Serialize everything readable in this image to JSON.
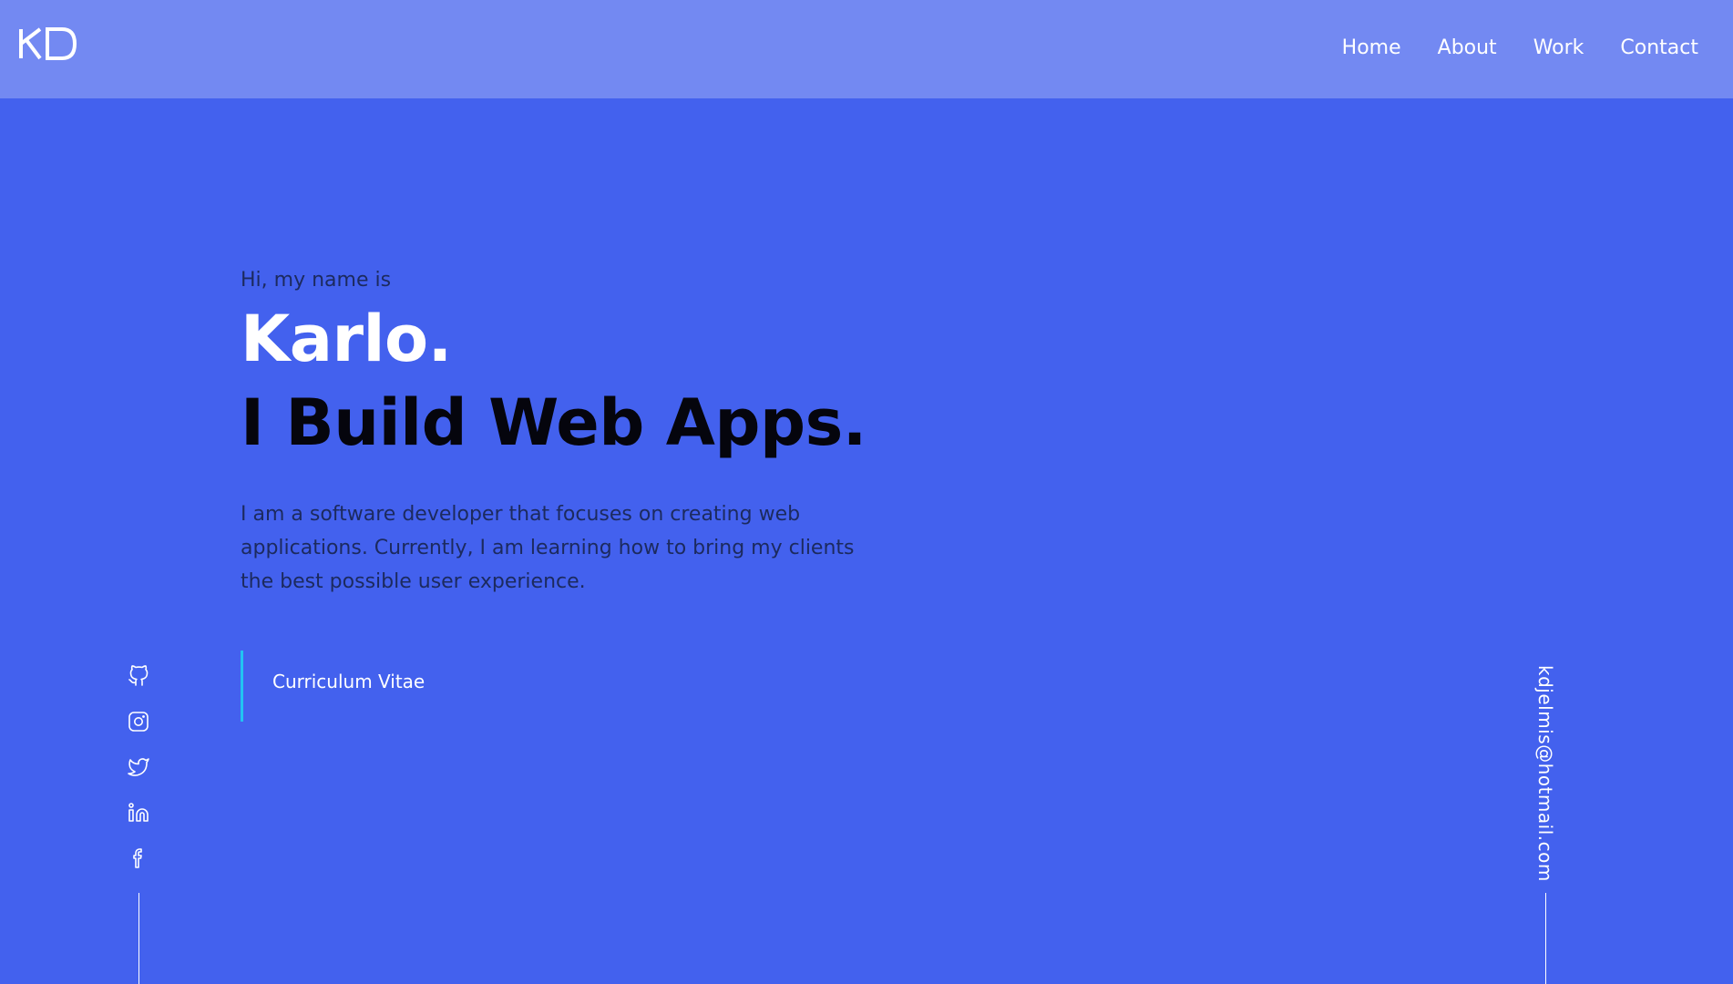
{
  "navbar": {
    "logo_text": "KD",
    "links": [
      {
        "label": "Home"
      },
      {
        "label": "About"
      },
      {
        "label": "Work"
      },
      {
        "label": "Contact"
      }
    ]
  },
  "hero": {
    "greeting": "Hi, my name is",
    "name": "Karlo.",
    "tagline": "I Build Web Apps.",
    "intro": "I am a software developer that focuses on creating web applications. Currently, I am learning how to bring my clients the best possible user experience.",
    "cv_label": "Curriculum Vitae"
  },
  "socials": [
    "github-icon",
    "instagram-icon",
    "twitter-icon",
    "linkedin-icon",
    "facebook-icon"
  ],
  "email": "kdjelmis@hotmail.com",
  "colors": {
    "background": "#4361ee",
    "navbar": "#7389f2",
    "accent": "#22c3f2",
    "heading_dark": "#05050d",
    "white": "#ffffff"
  }
}
